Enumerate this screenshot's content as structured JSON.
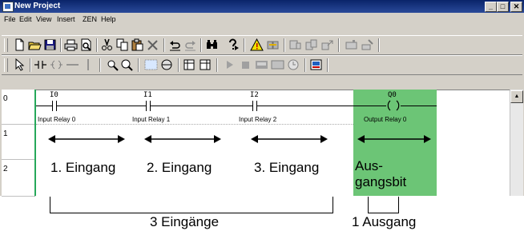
{
  "window": {
    "title": "New Project",
    "controls": [
      "_",
      "□",
      "✕"
    ]
  },
  "menu": [
    "File",
    "Edit",
    "View",
    "Insert",
    "ZEN",
    "Help"
  ],
  "toolbar1_icons": [
    "new-file-icon",
    "open-folder-icon",
    "save-icon",
    "print-icon",
    "print-preview-icon",
    "cut-icon",
    "copy-icon",
    "paste-icon",
    "delete-icon",
    "undo-icon",
    "redo-icon",
    "find-icon",
    "help-icon",
    "warning-check-icon",
    "transfer-icon",
    "monitor-icon",
    "compare-icon",
    "upload-icon",
    "download-icon"
  ],
  "toolbar2_icons": [
    "select-arrow-icon",
    "contact-icon",
    "coil-icon",
    "horizontal-line-icon",
    "vertical-line-icon",
    "zoom-in-icon",
    "zoom-out-icon",
    "grid-icon",
    "reel-icon",
    "function-block-a-icon",
    "function-block-b-icon",
    "run-icon",
    "stop-icon",
    "panel-icon",
    "window-icon",
    "clock-icon",
    "lcd-icon"
  ],
  "rows": [
    "0",
    "1",
    "2"
  ],
  "ladder": {
    "contacts": [
      {
        "address": "I0",
        "label": "Input Relay 0"
      },
      {
        "address": "I1",
        "label": "Input Relay 1"
      },
      {
        "address": "I2",
        "label": "Input Relay 2"
      }
    ],
    "coil": {
      "address": "Q0",
      "label": "Output Relay 0"
    }
  },
  "annotations": {
    "inputs": [
      "1. Eingang",
      "2. Eingang",
      "3. Eingang"
    ],
    "output_line1": "Aus-",
    "output_line2": "gangsbit",
    "inputs_total": "3 Eingänge",
    "outputs_total": "1 Ausgang"
  },
  "colors": {
    "output_highlight": "#6cc576",
    "title_bar": "#0a246a"
  }
}
